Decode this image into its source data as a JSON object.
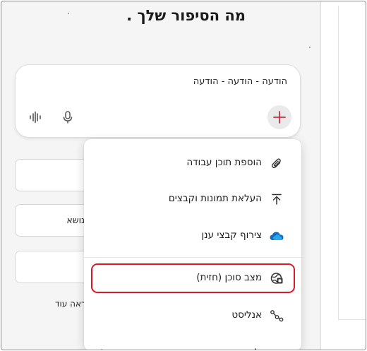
{
  "page": {
    "title": "מה הסיפור שלך ."
  },
  "composer": {
    "text": "הודעה - הודעה - הודעה",
    "add_label": "+"
  },
  "background_cards": [
    {
      "label": ""
    },
    {
      "label": "נושא"
    },
    {
      "label": ""
    }
  ],
  "see_more": "ראה עוד",
  "menu": {
    "items": [
      {
        "label": "הוספת תוכן עבודה",
        "icon": "paperclip-icon"
      },
      {
        "label": "העלאת תמונות וקבצים",
        "icon": "upload-icon"
      },
      {
        "label": "צירוף קבצי ענן",
        "icon": "cloud-icon"
      },
      {
        "label": "מצב סוכן (חזית)",
        "icon": "agent-mode-icon"
      },
      {
        "label": "אנליסט",
        "icon": "analyst-icon"
      }
    ]
  },
  "colors": {
    "accent": "#c4314b",
    "highlight": "#d71a26",
    "cloud": "#0f6cbd"
  }
}
